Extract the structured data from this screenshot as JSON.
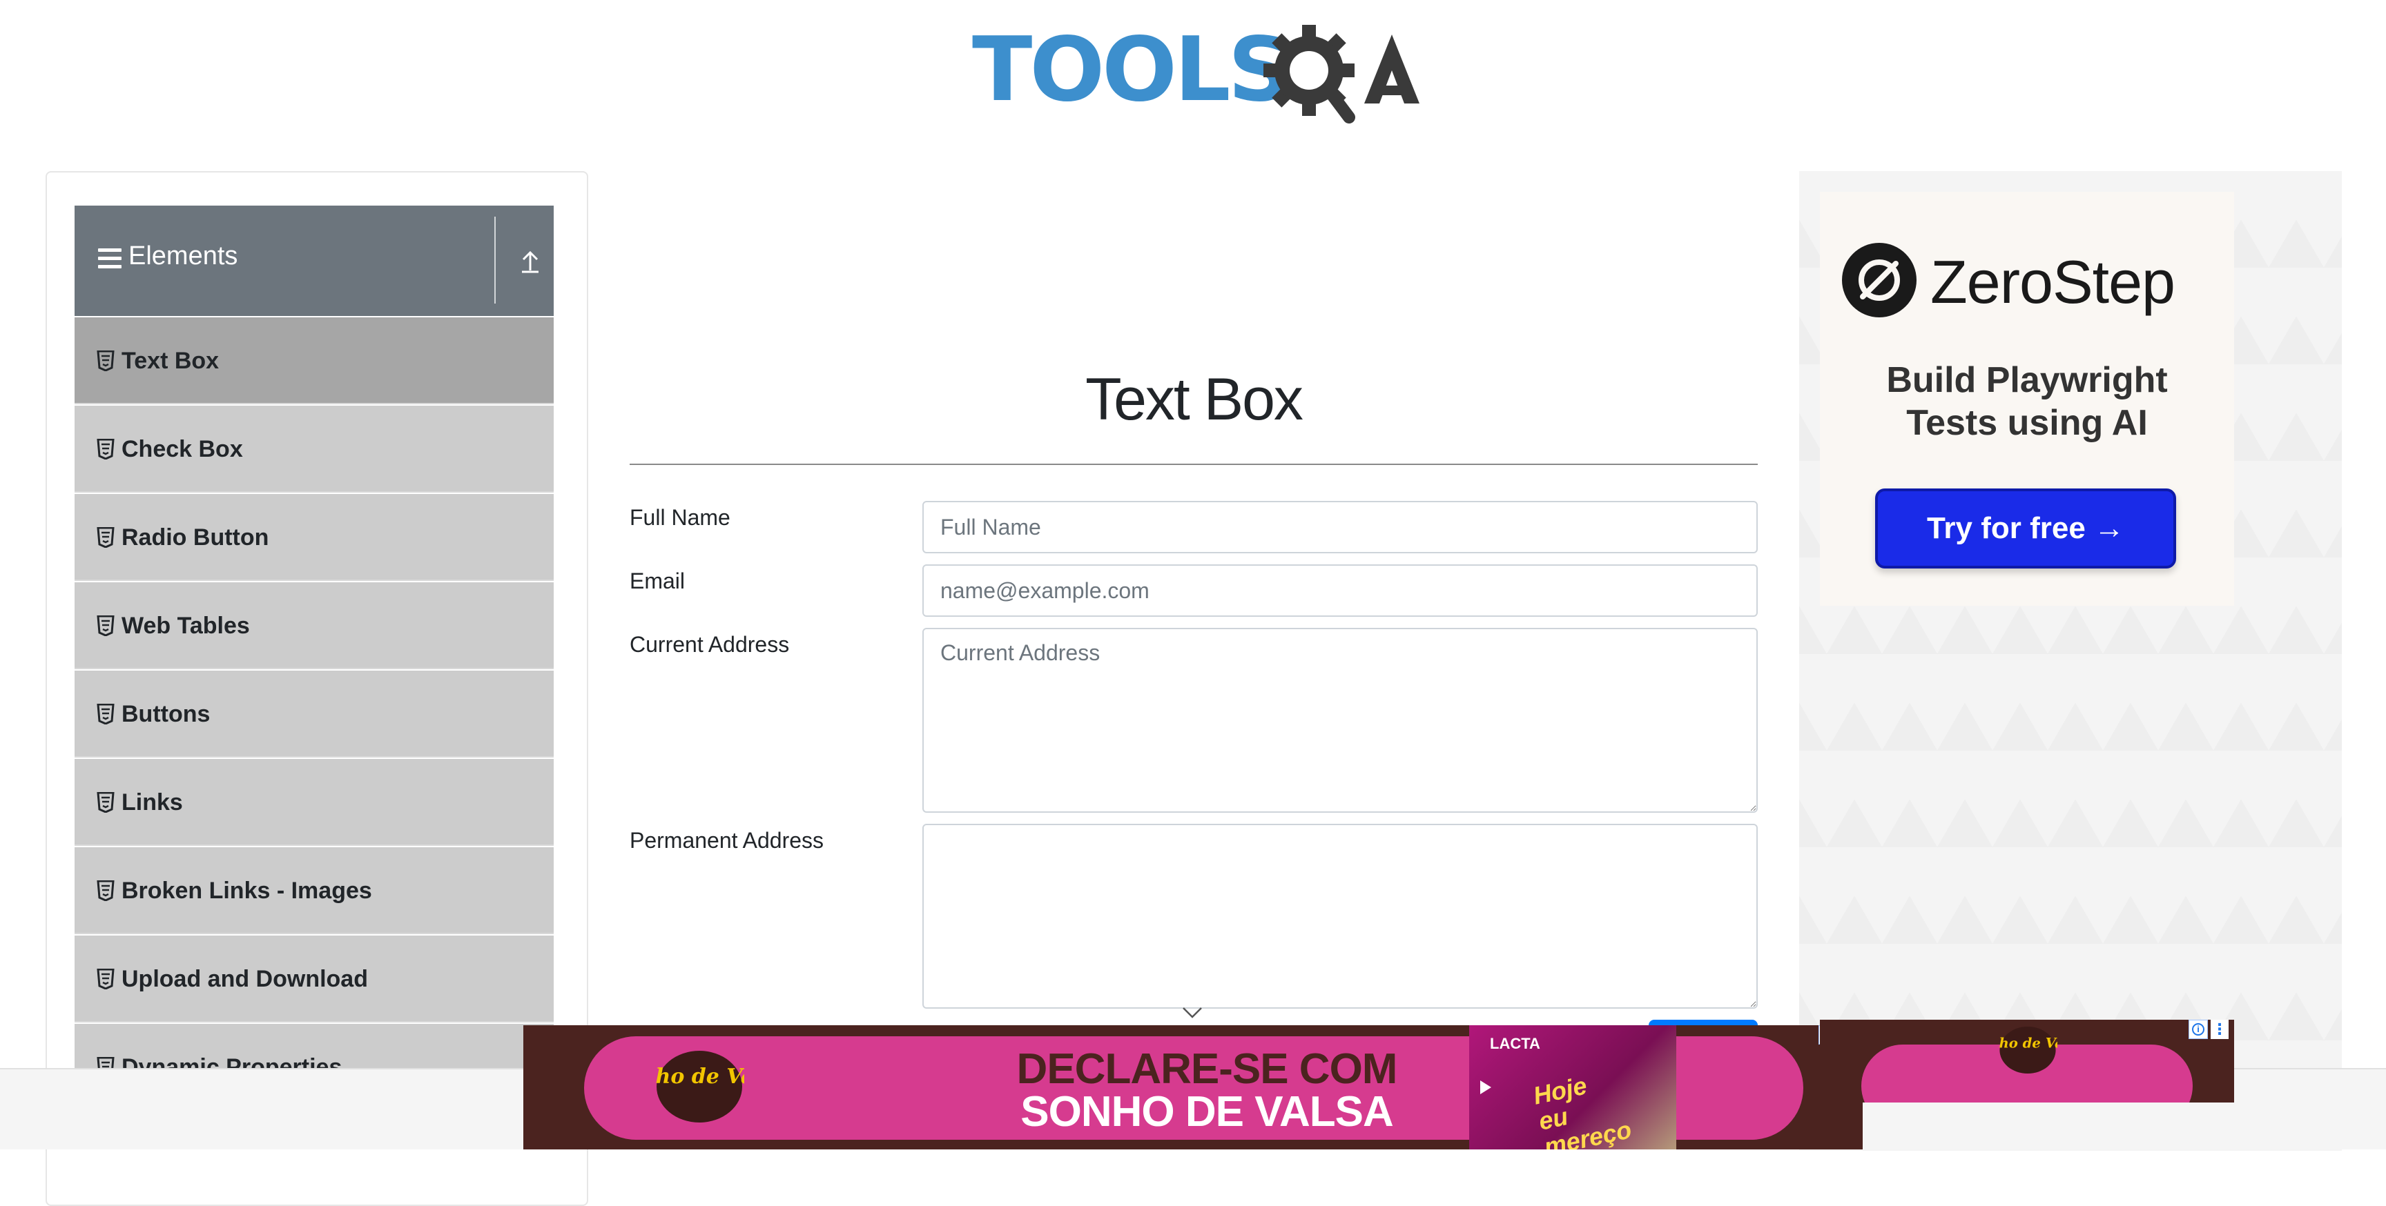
{
  "header": {
    "logo_text": "TOOLSQA",
    "logo_word": "TOOLS"
  },
  "sidebar": {
    "group_title": "Elements",
    "items": [
      {
        "label": "Text Box",
        "active": true
      },
      {
        "label": "Check Box"
      },
      {
        "label": "Radio Button"
      },
      {
        "label": "Web Tables"
      },
      {
        "label": "Buttons"
      },
      {
        "label": "Links"
      },
      {
        "label": "Broken Links - Images"
      },
      {
        "label": "Upload and Download"
      },
      {
        "label": "Dynamic Properties"
      }
    ]
  },
  "main": {
    "title": "Text Box",
    "fields": {
      "full_name": {
        "label": "Full Name",
        "placeholder": "Full Name",
        "value": ""
      },
      "email": {
        "label": "Email",
        "placeholder": "name@example.com",
        "value": ""
      },
      "current_address": {
        "label": "Current Address",
        "placeholder": "Current Address",
        "value": ""
      },
      "permanent_address": {
        "label": "Permanent Address",
        "placeholder": "",
        "value": ""
      }
    }
  },
  "right_ad": {
    "brand": "ZeroStep",
    "tagline_line1": "Build Playwright",
    "tagline_line2": "Tests using AI",
    "cta": "Try for free →"
  },
  "bottom_ad": {
    "line1": "DECLARE-SE COM",
    "line2": "SONHO DE VALSA",
    "product_brand": "LACTA",
    "promo_line1": "Hoje",
    "promo_line2": "eu",
    "promo_line3": "mereço",
    "logo_text": "Sonho de Valsa"
  },
  "colors": {
    "accent_blue": "#007bff",
    "sidebar_header": "#6c757d",
    "menu_item": "#cccccc",
    "menu_item_active": "#a6a6a6",
    "logo_blue": "#3d8fcd",
    "logo_dark": "#3a3a3a",
    "zerostep_cta": "#1a2be8",
    "ad_pink": "#d63b8f",
    "ad_brown": "#4b231f"
  },
  "icons": {
    "menu": "hamburger-icon",
    "collapse": "collapse-arrow-icon",
    "item": "html5-shield-icon",
    "logo_gear": "gear-magnifier-icon"
  }
}
